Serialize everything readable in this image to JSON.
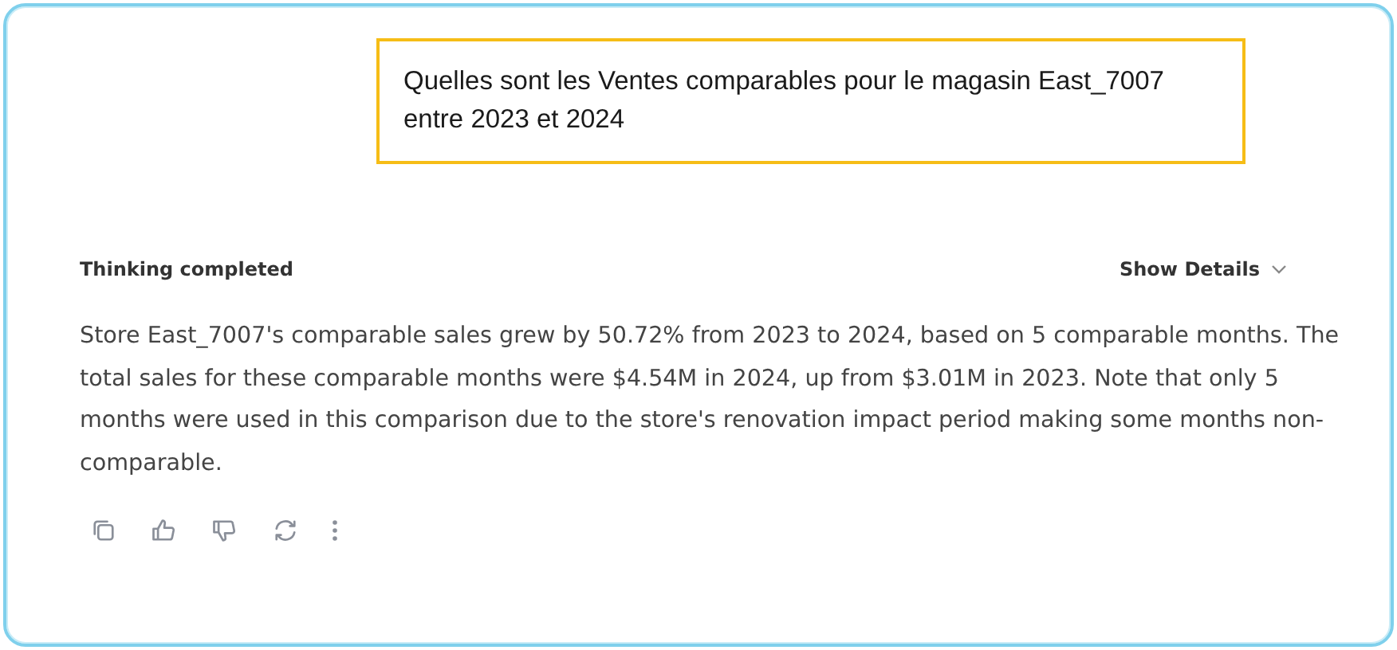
{
  "question": "Quelles sont les Ventes comparables pour le magasin East_7007 entre 2023 et 2024",
  "status": "Thinking completed",
  "details_toggle": {
    "label": "Show Details",
    "expanded": false
  },
  "answer": "Store East_7007's comparable sales grew by 50.72% from 2023 to 2024, based on 5 comparable months. The total sales for these comparable months were $4.54M in 2024, up from $3.01M in 2023. Note that only 5 months were used in this comparison due to the store's renovation impact period making some months non-comparable.",
  "actions": [
    {
      "kind": "copy"
    },
    {
      "kind": "like"
    },
    {
      "kind": "dislike"
    },
    {
      "kind": "regenerate"
    },
    {
      "kind": "more"
    }
  ]
}
